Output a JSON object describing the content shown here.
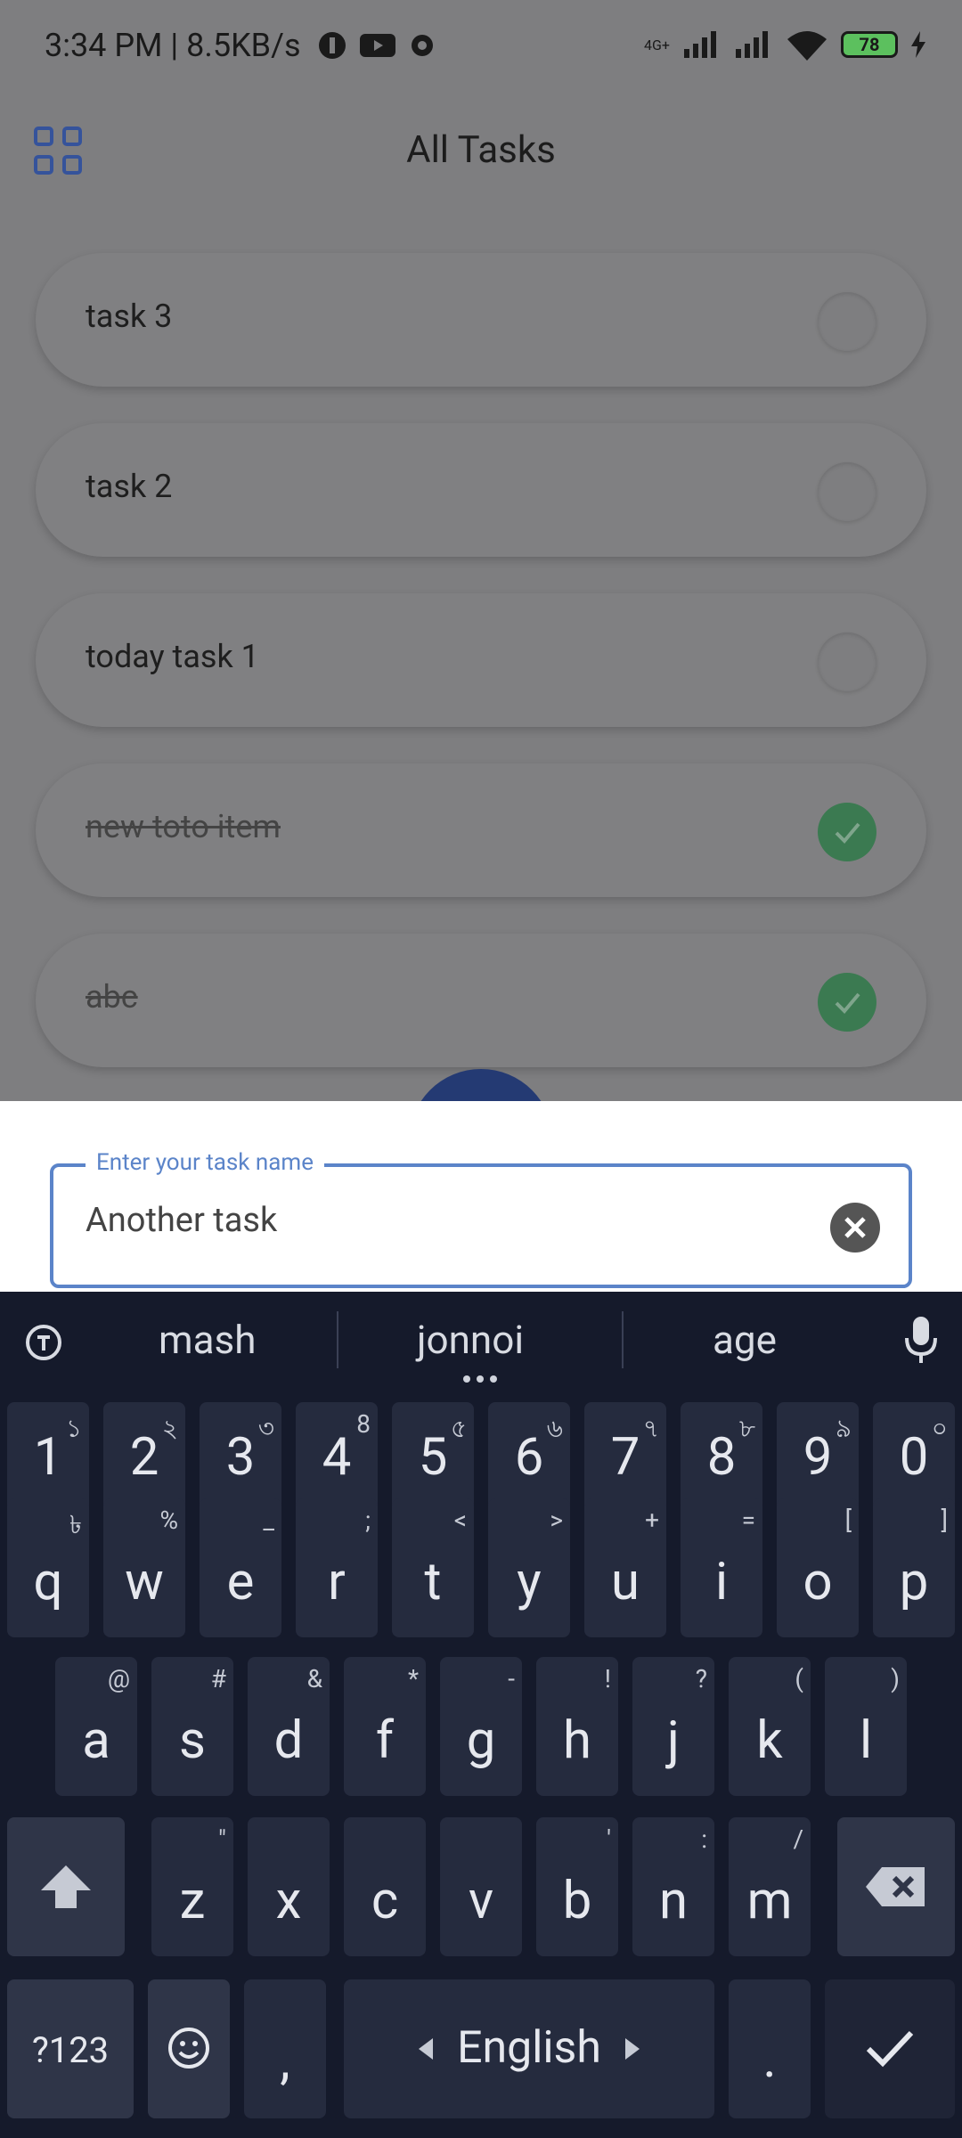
{
  "status_bar": {
    "time": "3:34 PM | 8.5KB/s",
    "network": "4G+",
    "battery": "78"
  },
  "header": {
    "title": "All Tasks",
    "menu_icon": "grid-icon"
  },
  "tasks": [
    {
      "label": "task 3",
      "done": false
    },
    {
      "label": "task 2",
      "done": false
    },
    {
      "label": "today task 1",
      "done": false
    },
    {
      "label": "new toto item",
      "done": true
    },
    {
      "label": "abc",
      "done": true
    }
  ],
  "sheet": {
    "field_label": "Enter your task name",
    "field_value": "Another task"
  },
  "keyboard": {
    "suggestions": [
      "mash",
      "jonnoi",
      "age"
    ],
    "numbers": [
      {
        "main": "1",
        "hint": "১"
      },
      {
        "main": "2",
        "hint": "২"
      },
      {
        "main": "3",
        "hint": "৩"
      },
      {
        "main": "4",
        "hint": "8"
      },
      {
        "main": "5",
        "hint": "৫"
      },
      {
        "main": "6",
        "hint": "৬"
      },
      {
        "main": "7",
        "hint": "৭"
      },
      {
        "main": "8",
        "hint": "৮"
      },
      {
        "main": "9",
        "hint": "৯"
      },
      {
        "main": "0",
        "hint": "০"
      }
    ],
    "row_q": [
      {
        "main": "q",
        "hint": "৳"
      },
      {
        "main": "w",
        "hint": "%"
      },
      {
        "main": "e",
        "hint": "_"
      },
      {
        "main": "r",
        "hint": ";"
      },
      {
        "main": "t",
        "hint": "<"
      },
      {
        "main": "y",
        "hint": ">"
      },
      {
        "main": "u",
        "hint": "+"
      },
      {
        "main": "i",
        "hint": "="
      },
      {
        "main": "o",
        "hint": "["
      },
      {
        "main": "p",
        "hint": "]"
      }
    ],
    "row_a": [
      {
        "main": "a",
        "hint": "@"
      },
      {
        "main": "s",
        "hint": "#"
      },
      {
        "main": "d",
        "hint": "&"
      },
      {
        "main": "f",
        "hint": "*"
      },
      {
        "main": "g",
        "hint": "-"
      },
      {
        "main": "h",
        "hint": "!"
      },
      {
        "main": "j",
        "hint": "?"
      },
      {
        "main": "k",
        "hint": "("
      },
      {
        "main": "l",
        "hint": ")"
      }
    ],
    "row_z": [
      {
        "main": "z",
        "hint": "\""
      },
      {
        "main": "x",
        "hint": ""
      },
      {
        "main": "c",
        "hint": ""
      },
      {
        "main": "v",
        "hint": ""
      },
      {
        "main": "b",
        "hint": "'"
      },
      {
        "main": "n",
        "hint": ":"
      },
      {
        "main": "m",
        "hint": "/"
      }
    ],
    "symbols_label": "?123",
    "comma": ",",
    "space_label": "English",
    "period": "."
  }
}
